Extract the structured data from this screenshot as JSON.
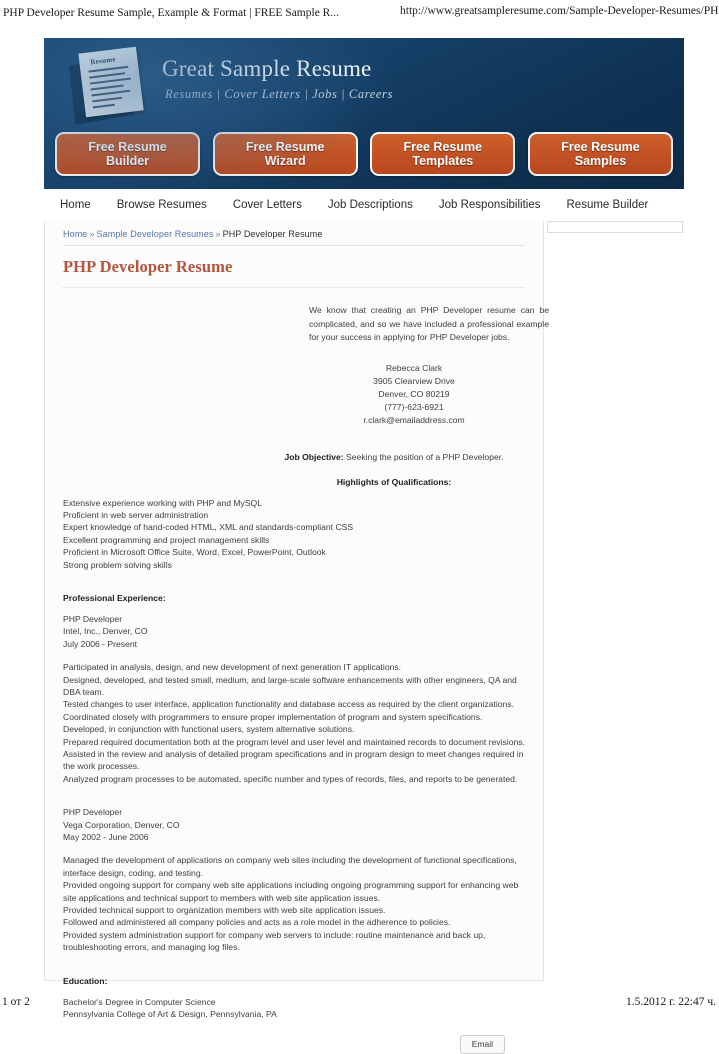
{
  "print": {
    "doc_title": "PHP Developer Resume Sample, Example & Format | FREE Sample R...",
    "url": "http://www.greatsampleresume.com/Sample-Developer-Resumes/PHP...",
    "page_number": "1 от 2",
    "timestamp": "1.5.2012 г. 22:47 ч."
  },
  "colors": {
    "header_blue": "#164068",
    "cta_orange": "#c25225",
    "title_red": "#b4553c",
    "link_blue": "#5576ad"
  },
  "header": {
    "logo_word": "Resume",
    "brand_title": "Great Sample Resume",
    "tagline": "Resumes | Cover Letters | Jobs | Careers",
    "cta_buttons": [
      {
        "line1": "Free Resume",
        "line2": "Builder"
      },
      {
        "line1": "Free Resume",
        "line2": "Wizard"
      },
      {
        "line1": "Free Resume",
        "line2": "Templates"
      },
      {
        "line1": "Free Resume",
        "line2": "Samples"
      }
    ]
  },
  "nav": {
    "items": [
      "Home",
      "Browse Resumes",
      "Cover Letters",
      "Job Descriptions",
      "Job Responsibilities",
      "Resume Builder"
    ]
  },
  "breadcrumb": {
    "home": "Home",
    "sep": "»",
    "parent": "Sample Developer Resumes",
    "current": "PHP Developer Resume"
  },
  "main": {
    "page_title": "PHP Developer Resume",
    "intro": "We know that creating an PHP Developer resume can be complicated, and so we have included a professional example for your success in applying for PHP Developer jobs.",
    "contact": {
      "name": "Rebecca Clark",
      "street": "3905 Clearview Drive",
      "city_state_zip": "Denver, CO 80219",
      "phone": "(777)-623-6921",
      "email": "r.clark@emailaddress.com"
    },
    "objective_label": "Job Objective:",
    "objective_text": "Seeking the position of a PHP Developer.",
    "highlights_heading": "Highlights of Qualifications:",
    "highlights": [
      "Extensive experience working with PHP and MySQL",
      "Proficient in web server administration",
      "Expert knowledge of hand-coded HTML, XML and standards-compliant CSS",
      "Excellent programming and project management skills",
      "Proficient in Microsoft Office Suite, Word, Excel, PowerPoint, Outlook",
      "Strong problem solving skills"
    ],
    "experience_heading": "Professional Experience:",
    "jobs": [
      {
        "title": "PHP Developer",
        "company": "Intel, Inc., Denver, CO",
        "dates": "July 2006 - Present",
        "duties": [
          "Participated in analysis, design, and new development of next generation IT applications.",
          "Designed, developed, and tested small, medium, and large-scale software enhancements with other engineers, QA and DBA team.",
          "Tested changes to user interface, application functionality and database access as required by the client organizations.",
          "Coordinated closely with programmers to ensure proper implementation of program and system specifications.",
          "Developed, in conjunction with functional users, system alternative solutions.",
          "Prepared required documentation both at the program level and user level and maintained records to document revisions.",
          "Assisted in the review and analysis of detailed program specifications and in program design to meet changes required in the work processes.",
          "Analyzed program processes to be automated, specific number and types of records, files, and reports to be generated."
        ]
      },
      {
        "title": "PHP Developer",
        "company": "Vega Corporation, Denver, CO",
        "dates": "May 2002 - June 2006",
        "duties": [
          "Managed the development of applications on company web sites including the development of functional specifications, interface design, coding, and testing.",
          "Provided ongoing support for company web site applications including ongoing programming support for enhancing web site applications and technical support to members with web site application issues.",
          "Provided technical support to organization members with web site application issues.",
          "Followed and administered all company policies and acts as a role model in the adherence to policies.",
          "Provided system administration support for company web servers to include: routine maintenance and back up, troubleshooting errors, and managing log files."
        ]
      }
    ],
    "education_heading": "Education:",
    "education": [
      "Bachelor's Degree in Computer Science",
      "Pennsylvania College of Art & Design, Pennsylvania, PA"
    ],
    "email_button": "Email"
  }
}
